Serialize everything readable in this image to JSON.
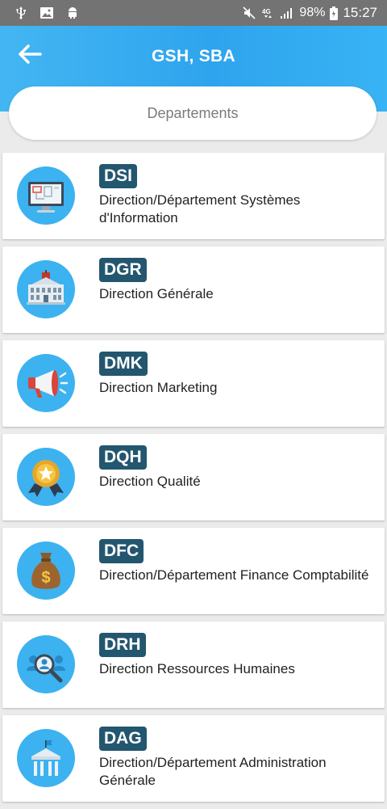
{
  "status_bar": {
    "icons_left": [
      "usb-icon",
      "image-icon",
      "android-icon"
    ],
    "icons_right": [
      "mute-icon",
      "4g-icon",
      "signal-icon",
      "battery-icon"
    ],
    "network": "4G",
    "battery": "98%",
    "time": "15:27"
  },
  "header": {
    "title": "GSH, SBA",
    "back_icon": "arrow-left-icon",
    "gradient": [
      "#43b6f2",
      "#2ea4ee",
      "#38b3f4"
    ]
  },
  "segment": {
    "label": "Departements"
  },
  "colors": {
    "badge": "#23566f",
    "avatar": "#3cb2f0",
    "background": "#ebebeb"
  },
  "departments": [
    {
      "code": "DSI",
      "name": "Direction/Département Systèmes d'Information",
      "icon": "computer-icon"
    },
    {
      "code": "DGR",
      "name": "Direction Générale",
      "icon": "building-icon"
    },
    {
      "code": "DMK",
      "name": "Direction Marketing",
      "icon": "megaphone-icon"
    },
    {
      "code": "DQH",
      "name": "Direction Qualité",
      "icon": "medal-icon"
    },
    {
      "code": "DFC",
      "name": "Direction/Département Finance Comptabilité",
      "icon": "money-bag-icon"
    },
    {
      "code": "DRH",
      "name": "Direction Ressources Humaines",
      "icon": "people-search-icon"
    },
    {
      "code": "DAG",
      "name": "Direction/Département Administration Générale",
      "icon": "institution-icon"
    }
  ]
}
